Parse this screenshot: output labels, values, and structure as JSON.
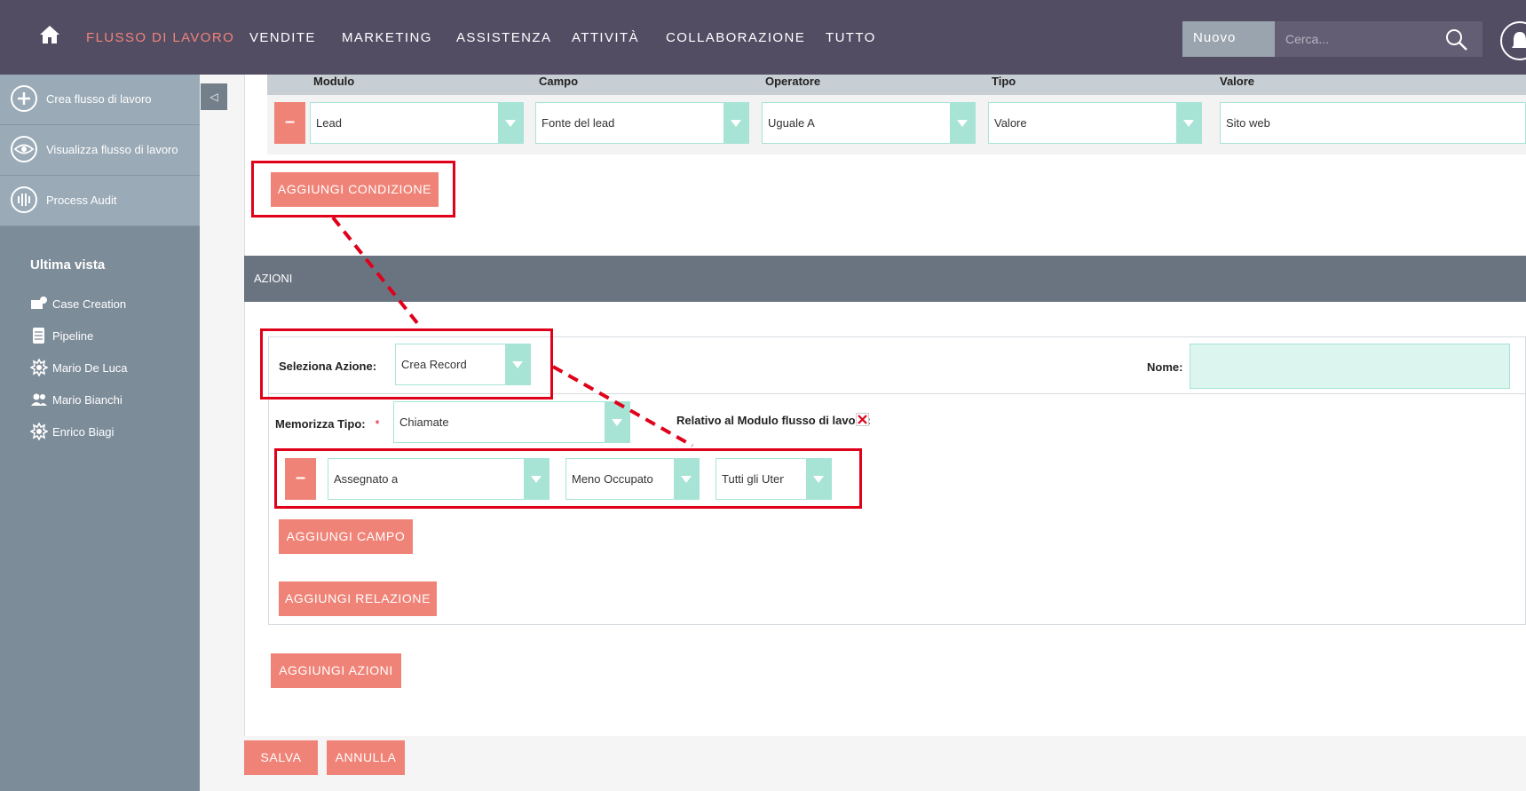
{
  "nav": {
    "items": [
      "FLUSSO DI LAVORO",
      "VENDITE",
      "MARKETING",
      "ASSISTENZA",
      "ATTIVITÀ",
      "COLLABORAZIONE",
      "TUTTO"
    ],
    "active_index": 0,
    "new_button": "Nuovo",
    "search_placeholder": "Cerca..."
  },
  "sidebar": {
    "actions": [
      "Crea flusso di lavoro",
      "Visualizza flusso di lavoro",
      "Process Audit"
    ],
    "recent_heading": "Ultima vista",
    "recent": [
      {
        "label": "Case Creation",
        "icon": "case-icon"
      },
      {
        "label": "Pipeline",
        "icon": "document-icon"
      },
      {
        "label": "Mario De Luca",
        "icon": "workflow-gear-icon"
      },
      {
        "label": "Mario Bianchi",
        "icon": "contacts-icon"
      },
      {
        "label": "Enrico Biagi",
        "icon": "workflow-gear-icon"
      }
    ]
  },
  "conditions": {
    "columns": [
      "Modulo",
      "Campo",
      "Operatore",
      "Tipo",
      "Valore"
    ],
    "row": [
      "Lead",
      "Fonte del lead",
      "Uguale A",
      "Valore",
      "Sito web"
    ],
    "add_button": "AGGIUNGI CONDIZIONE"
  },
  "actions": {
    "header": "AZIONI",
    "select_action_label": "Seleziona Azione:",
    "select_action_value": "Crea Record",
    "name_label": "Nome:",
    "store_type_label": "Memorizza Tipo:",
    "required_mark": "*",
    "store_type_value": "Chiamate",
    "related_label": "Relativo al Modulo flusso di lavoro:",
    "field_row": [
      "Assegnato a",
      "Meno Occupato",
      "Tutti gli Uten"
    ],
    "add_field": "AGGIUNGI CAMPO",
    "add_relation": "AGGIUNGI RELAZIONE",
    "add_actions": "AGGIUNGI AZIONI"
  },
  "footer": {
    "save": "SALVA",
    "cancel": "ANNULLA"
  },
  "colors": {
    "topbar": "#534d64",
    "accent": "#f08377",
    "select_border": "#a7e4d6",
    "highlight": "#e0001a"
  }
}
